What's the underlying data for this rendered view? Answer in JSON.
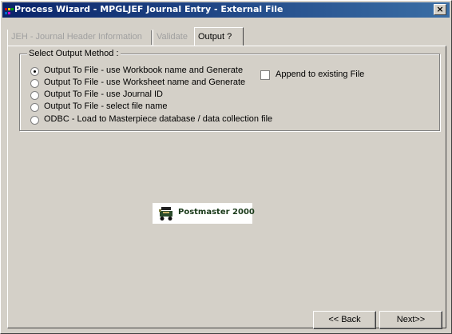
{
  "window": {
    "title": "Process Wizard - MPGLJEF Journal Entry - External File",
    "close_label": "×"
  },
  "tabs": [
    {
      "label": "JEH - Journal Header Information",
      "active": false
    },
    {
      "label": "Validate",
      "active": false
    },
    {
      "label": "Output ?",
      "active": true
    }
  ],
  "output_method": {
    "legend": "Select Output Method :",
    "options": [
      {
        "label": "Output To File - use Workbook name and Generate",
        "selected": true
      },
      {
        "label": "Output To File - use Worksheet name and Generate",
        "selected": false
      },
      {
        "label": "Output To File - use Journal ID",
        "selected": false
      },
      {
        "label": "Output To File - select file name",
        "selected": false
      },
      {
        "label": "ODBC - Load to Masterpiece database / data collection file",
        "selected": false
      }
    ],
    "append_checkbox": {
      "label": "Append to existing File",
      "checked": false
    }
  },
  "logo": {
    "text": "Postmaster 2000"
  },
  "buttons": {
    "back": "<< Back",
    "next": "Next>>"
  }
}
